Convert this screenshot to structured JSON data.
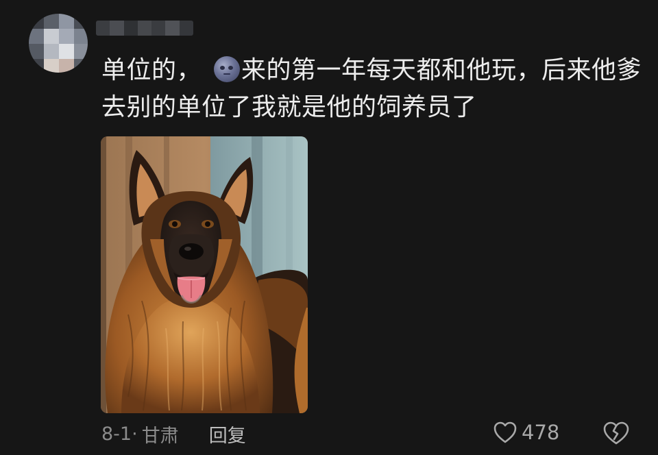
{
  "comment": {
    "line1_before_emoji": "单位的，",
    "emoji_icon": "new-moon-face-icon",
    "line1_after_emoji": "来的第一年每天都和他玩，后来他爹",
    "line2": "去别的单位了我就是他的饲养员了"
  },
  "meta": {
    "date": "8-1·",
    "location": "甘肃",
    "reply_label": "回复"
  },
  "actions": {
    "like_icon": "heart-outline-icon",
    "like_count": "478",
    "dislike_icon": "broken-heart-outline-icon"
  },
  "colors": {
    "background": "#161616",
    "text": "#ededed",
    "meta": "#8c8c8c"
  }
}
